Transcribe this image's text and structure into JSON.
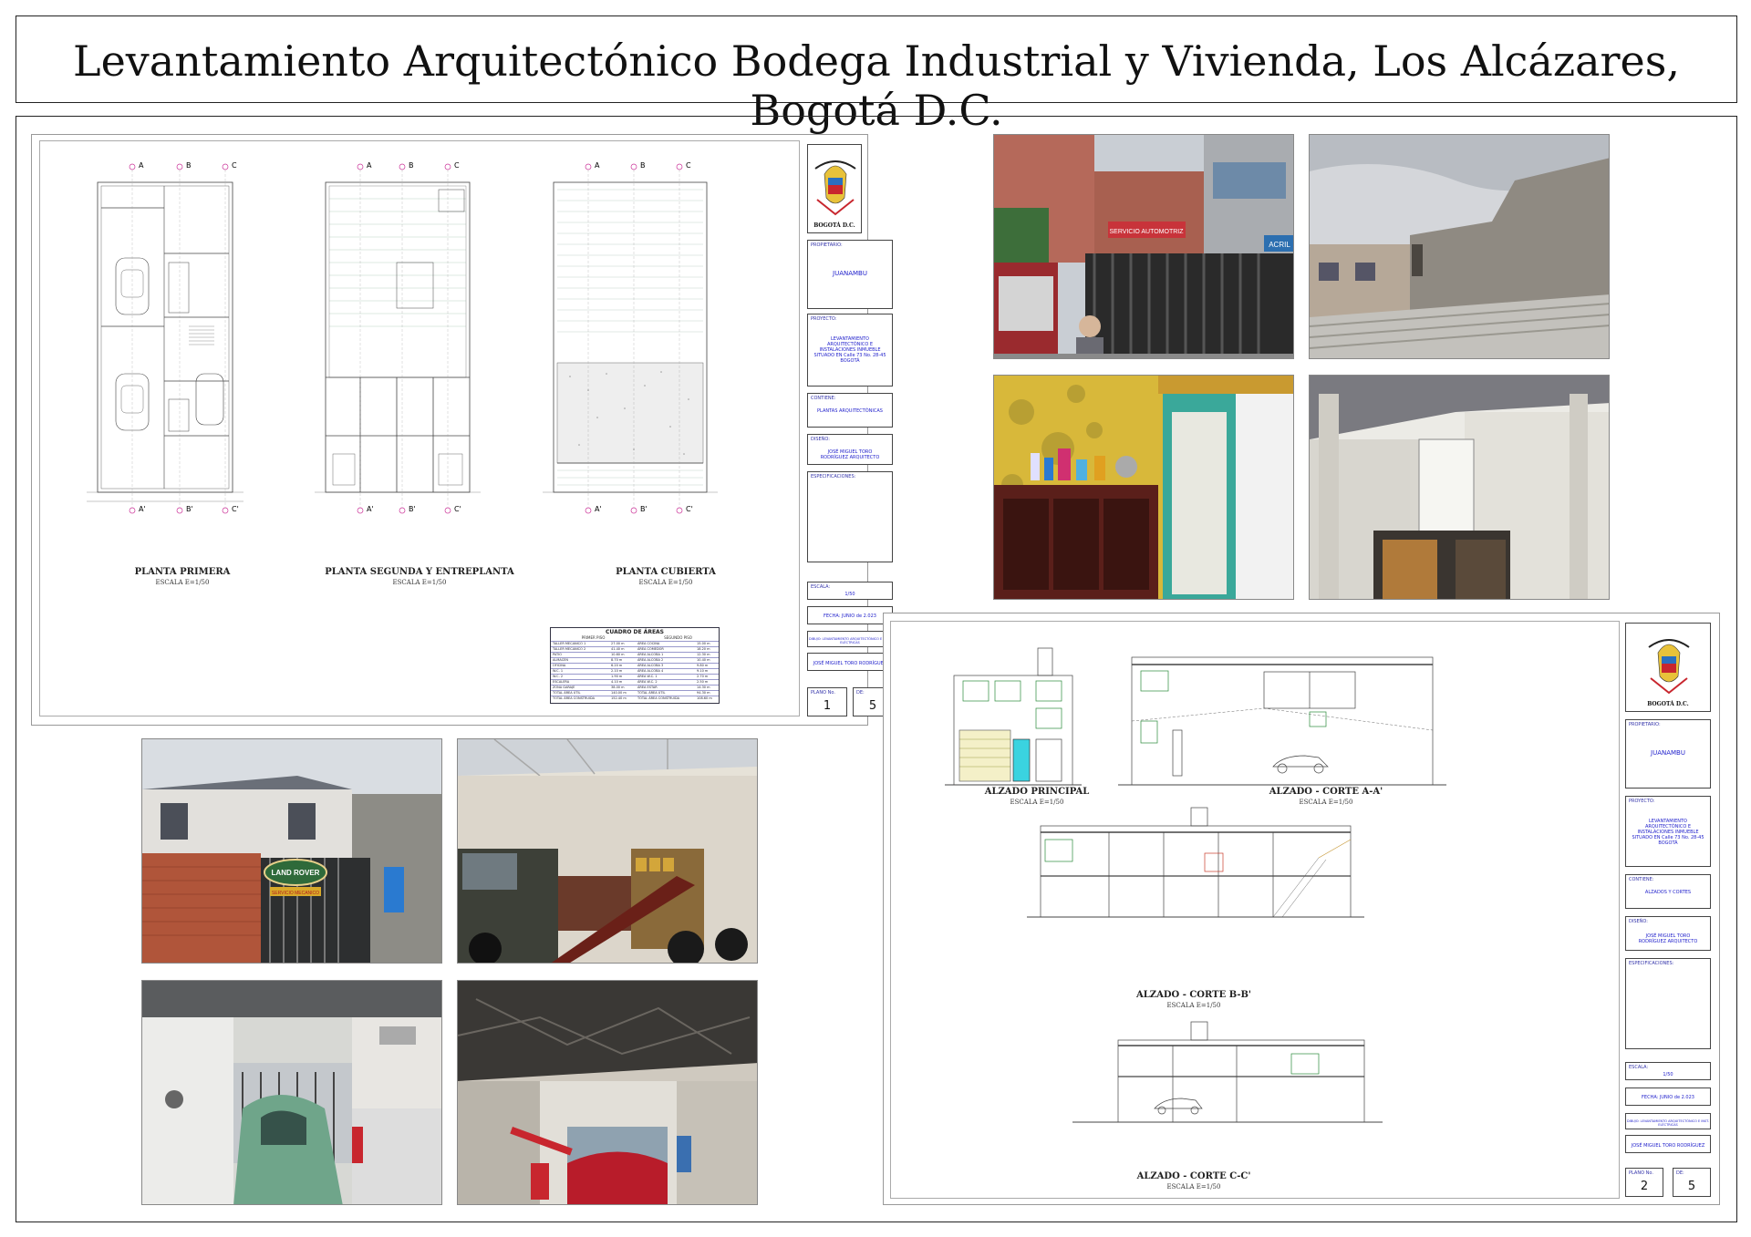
{
  "title": "Levantamiento Arquitectónico Bodega Industrial y Vivienda, Los Alcázares, Bogotá D.C.",
  "sheet1": {
    "plans": [
      {
        "label": "PLANTA PRIMERA",
        "scale": "ESCALA E=1/50"
      },
      {
        "label": "PLANTA SEGUNDA Y ENTREPLANTA",
        "scale": "ESCALA E=1/50"
      },
      {
        "label": "PLANTA CUBIERTA",
        "scale": "ESCALA E=1/50"
      }
    ],
    "axis_top": [
      "A",
      "B",
      "C"
    ],
    "axis_bottom": [
      "A'",
      "B'",
      "C'"
    ],
    "areas_table": {
      "title": "CUADRO DE ÁREAS",
      "col_left": "PRIMER PISO",
      "col_right": "SEGUNDO PISO",
      "rows": [
        [
          "TALLER MECANICO 1",
          "27.00 m",
          "ÁREA COCINA",
          "15.00 m"
        ],
        [
          "TALLER MECANICO 2",
          "41.40 m",
          "ÁREA COMEDOR",
          "18.20 m"
        ],
        [
          "PATIO",
          "10.60 m",
          "ÁREA ALCOBA 1",
          "12.30 m"
        ],
        [
          "ALMACEN",
          "8.70 m",
          "ÁREA ALCOBA 2",
          "10.40 m"
        ],
        [
          "OFICINA",
          "6.20 m",
          "ÁREA ALCOBA 3",
          "9.80 m"
        ],
        [
          "W.C. 1",
          "2.10 m",
          "ÁREA ALCOBA 4",
          "9.10 m"
        ],
        [
          "W.C. 2",
          "1.90 m",
          "ÁREA W.C. 1",
          "2.70 m"
        ],
        [
          "ESCALERA",
          "4.10 m",
          "ÁREA W.C. 2",
          "2.50 m"
        ],
        [
          "ZONA GARAJE",
          "38.00 m",
          "ÁREA ESTAR",
          "14.30 m"
        ],
        [
          "TOTAL ÁREA ÚTIL",
          "140.00 m",
          "TOTAL ÁREA ÚTIL",
          "94.30 m"
        ],
        [
          "TOTAL ÁREA CONSTRUIDA",
          "152.40 m",
          "TOTAL ÁREA CONSTRUIDA",
          "108.60 m"
        ]
      ]
    },
    "title_block": {
      "crest_caption": "BOGOTÁ D.C.",
      "propietario_label": "PROPIETARIO:",
      "propietario": "JUANAMBU",
      "proyecto_label": "PROYECTO:",
      "proyecto": "LEVANTAMIENTO ARQUITECTÓNICO E INSTALACIONES INMUEBLE SITUADO EN Calle 73 No. 28-45 BOGOTÁ",
      "contiene_label": "CONTIENE:",
      "contiene": "PLANTAS ARQUITECTÓNICAS",
      "diseno_label": "DISEÑO:",
      "diseno": "JOSÉ MIGUEL TORO RODRÍGUEZ ARQUITECTO",
      "especificaciones_label": "ESPECIFICACIONES:",
      "escala_label": "ESCALA:",
      "escala": "1/50",
      "fecha": "FECHA: JUNIO de 2.023",
      "nota": "DIBUJO: LEVANTAMIENTO ARQUITECTÓNICO E INST. ELÉCTRICAS",
      "dibujo": "JOSÉ MIGUEL TORO RODRÍGUEZ",
      "plano_label": "PLANO No.",
      "de_label": "DE:",
      "plano_num": "1",
      "total": "5"
    }
  },
  "sheet2": {
    "views": [
      {
        "label": "ALZADO PRINCIPAL",
        "scale": "ESCALA E=1/50"
      },
      {
        "label": "ALZADO - CORTE A-A'",
        "scale": "ESCALA E=1/50"
      },
      {
        "label": "ALZADO - CORTE B-B'",
        "scale": "ESCALA E=1/50"
      },
      {
        "label": "ALZADO - CORTE C-C'",
        "scale": "ESCALA E=1/50"
      }
    ],
    "title_block": {
      "crest_caption": "BOGOTÁ D.C.",
      "propietario_label": "PROPIETARIO:",
      "propietario": "JUANAMBU",
      "proyecto_label": "PROYECTO:",
      "proyecto": "LEVANTAMIENTO ARQUITECTÓNICO E INSTALACIONES INMUEBLE SITUADO EN Calle 73 No. 28-45 BOGOTÁ",
      "contiene_label": "CONTIENE:",
      "contiene": "ALZADOS Y CORTES",
      "diseno_label": "DISEÑO:",
      "diseno": "JOSÉ MIGUEL TORO RODRÍGUEZ ARQUITECTO",
      "especificaciones_label": "ESPECIFICACIONES:",
      "escala_label": "ESCALA:",
      "escala": "1/50",
      "fecha": "FECHA: JUNIO de 2.023",
      "nota": "DIBUJO: LEVANTAMIENTO ARQUITECTÓNICO E INST. ELÉCTRICAS",
      "dibujo": "JOSÉ MIGUEL TORO RODRÍGUEZ",
      "plano_label": "PLANO No.",
      "de_label": "DE:",
      "plano_num": "2",
      "total": "5"
    }
  },
  "photos": {
    "street_sign": "LAND ROVER",
    "sign_sub": "SERVICIO MECANICO",
    "shop_sign": "SERVICIO AUTOMOTRIZ",
    "shop_sign2": "ACRIL"
  },
  "colors": {
    "frame": "#222222",
    "drawing_line": "#444444",
    "axis_marker": "#cc3399",
    "title_block_text": "#2222cc",
    "areas_table_border": "#3333aa",
    "yellow_wall": "#d8b83a",
    "green_door": "#3aa89a",
    "red_car": "#b81c2a"
  }
}
